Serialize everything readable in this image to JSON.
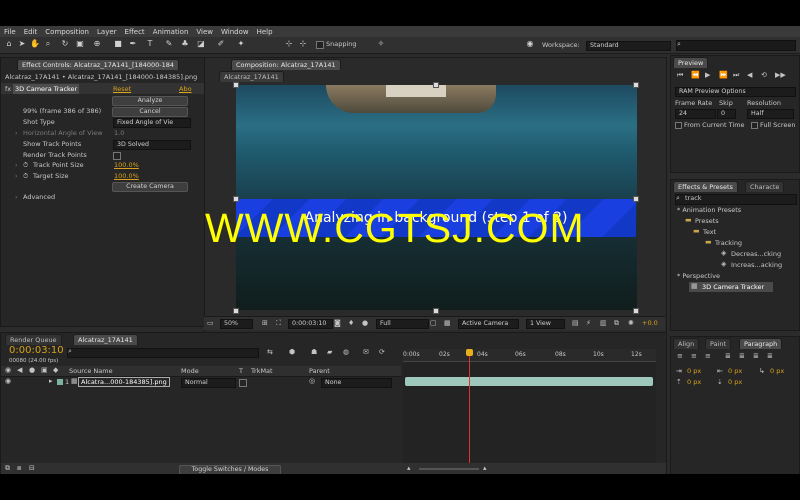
{
  "menu": [
    "File",
    "Edit",
    "Composition",
    "Layer",
    "Effect",
    "Animation",
    "View",
    "Window",
    "Help"
  ],
  "toolbar": {
    "snapping_label": "Snapping",
    "workspace_label": "Workspace:",
    "workspace_value": "Standard"
  },
  "effect_controls": {
    "tab_label": "Effect Controls: Alcatraz_17A141_[184000-184",
    "breadcrumb": "Alcatraz_17A141 • Alcatraz_17A141_[184000-184385].png",
    "effect_name": "3D Camera Tracker",
    "reset_label": "Reset",
    "about_label": "Abo",
    "analyze_label": "Analyze",
    "progress_text": "99% (frame 386 of 386)",
    "cancel_label": "Cancel",
    "shot_type_label": "Shot Type",
    "shot_type_value": "Fixed Angle of Vie",
    "fov_label": "Horizontal Angle of View",
    "fov_value": "1.0",
    "show_track_points_label": "Show Track Points",
    "show_track_points_value": "3D Solved",
    "render_track_points_label": "Render Track Points",
    "track_point_size_label": "Track Point Size",
    "track_point_size_value": "100.0%",
    "target_size_label": "Target Size",
    "target_size_value": "100.0%",
    "create_camera_label": "Create Camera",
    "advanced_label": "Advanced"
  },
  "composition": {
    "tab_label": "Composition: Alcatraz_17A141",
    "subtab_label": "Alcatraz_17A141",
    "banner_text": "Analyzing in background (step 1 of 2)",
    "zoom": "50%",
    "timecode": "0:00:03:10",
    "resolution": "Full",
    "camera": "Active Camera",
    "view": "1 View",
    "exposure": "+0.0"
  },
  "watermark": "WWW.CGTSJ.COM",
  "preview": {
    "tab_label": "Preview",
    "ram_options": "RAM Preview Options",
    "frame_rate_label": "Frame Rate",
    "frame_rate_value": "24",
    "skip_label": "Skip",
    "skip_value": "0",
    "resolution_label": "Resolution",
    "resolution_value": "Half",
    "from_current_label": "From Current Time",
    "full_screen_label": "Full Screen"
  },
  "effects_presets": {
    "tab_label": "Effects & Presets",
    "tab2_label": "Characte",
    "search_value": "track",
    "tree": [
      "* Animation Presets",
      "Presets",
      "Text",
      "Tracking",
      "Decreas...cking",
      "Increas...acking",
      "* Perspective",
      "3D Camera Tracker"
    ]
  },
  "timeline": {
    "render_queue_label": "Render Queue",
    "comp_tab_label": "Alcatraz_17A141",
    "timecode": "0:00:03:10",
    "fps": "00080 (24.00 fps)",
    "columns": [
      "Source Name",
      "Mode",
      "T",
      "TrkMat",
      "Parent"
    ],
    "layer_number": "1",
    "layer_name": "Alcatra...000-184385].png",
    "layer_mode": "Normal",
    "layer_parent": "None",
    "ruler": [
      "0:00s",
      "02s",
      "04s",
      "06s",
      "08s",
      "10s",
      "12s"
    ],
    "toggle_label": "Toggle Switches / Modes"
  },
  "align_panel": {
    "tabs": [
      "Align",
      "Paint",
      "Paragraph"
    ],
    "px_values": [
      "0 px",
      "0 px",
      "0 px",
      "0 px",
      "0 px"
    ]
  },
  "colors": {
    "accent": "#d9a21a",
    "banner": "#1a3fe0",
    "watermark": "#ffff00",
    "playhead": "#e03030",
    "track_bar": "#9fc8bd"
  }
}
